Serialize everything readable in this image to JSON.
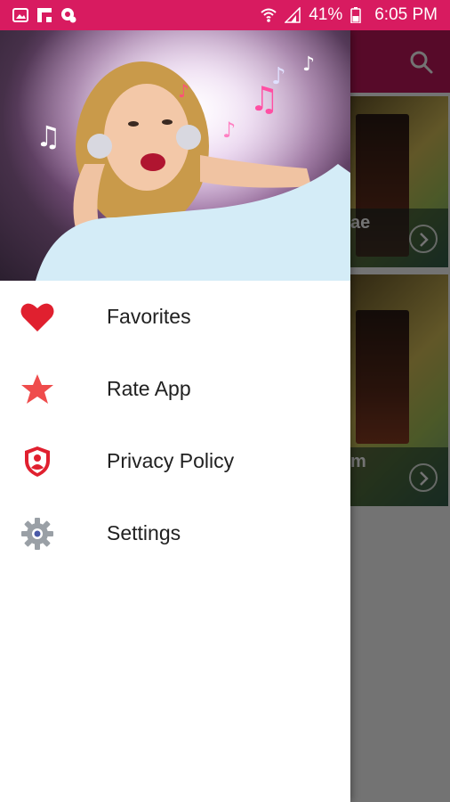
{
  "status_bar": {
    "battery": "41%",
    "time": "6:05 PM",
    "left_icons": [
      "gallery-icon",
      "flipboard-icon",
      "app-notification-icon"
    ],
    "right_icons": [
      "wifi-icon",
      "signal-icon",
      "battery-icon"
    ]
  },
  "drawer": {
    "menu": [
      {
        "label": "Favorites",
        "icon": "heart-icon"
      },
      {
        "label": "Rate App",
        "icon": "star-icon"
      },
      {
        "label": "Privacy Policy",
        "icon": "privacy-shield-icon"
      },
      {
        "label": "Settings",
        "icon": "gear-icon"
      }
    ]
  },
  "background": {
    "cards": [
      {
        "title_fragment": "ae"
      },
      {
        "title_fragment": "m"
      }
    ]
  },
  "colors": {
    "status_bar": "#d81b60",
    "toolbar": "#c2185b",
    "accent": "#e53935"
  }
}
